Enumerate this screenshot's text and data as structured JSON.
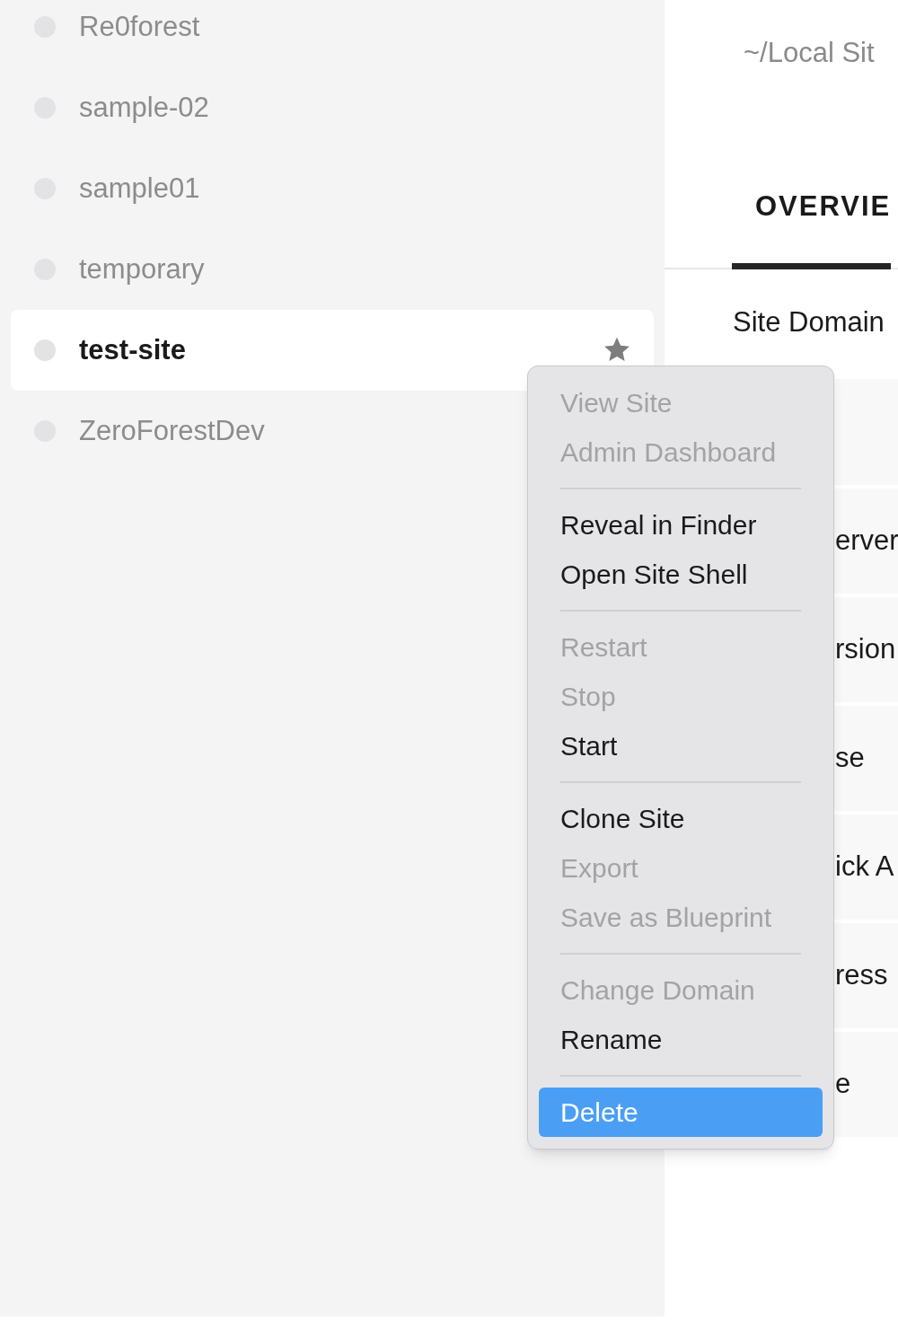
{
  "sidebar": {
    "items": [
      {
        "label": "Re0forest",
        "selected": false,
        "starred": false
      },
      {
        "label": "sample-02",
        "selected": false,
        "starred": false
      },
      {
        "label": "sample01",
        "selected": false,
        "starred": false
      },
      {
        "label": "temporary",
        "selected": false,
        "starred": false
      },
      {
        "label": "test-site",
        "selected": true,
        "starred": true
      },
      {
        "label": "ZeroForestDev",
        "selected": false,
        "starred": false
      }
    ]
  },
  "main": {
    "path": "~/Local Sit",
    "tabs": [
      {
        "label": "OVERVIE",
        "selected": true
      }
    ],
    "rows": [
      {
        "label": "Site Domain",
        "kind": "full"
      },
      {
        "label": "",
        "kind": "blank"
      },
      {
        "label": "erver",
        "kind": "covered"
      },
      {
        "label": "rsion",
        "kind": "covered"
      },
      {
        "label": "se",
        "kind": "covered"
      },
      {
        "label": "ick A",
        "kind": "covered"
      },
      {
        "label": "ress",
        "kind": "covered"
      },
      {
        "label": "e",
        "kind": "covered"
      }
    ]
  },
  "context_menu": {
    "groups": [
      [
        {
          "label": "View Site",
          "disabled": true,
          "selected": false
        },
        {
          "label": "Admin Dashboard",
          "disabled": true,
          "selected": false
        }
      ],
      [
        {
          "label": "Reveal in Finder",
          "disabled": false,
          "selected": false
        },
        {
          "label": "Open Site Shell",
          "disabled": false,
          "selected": false
        }
      ],
      [
        {
          "label": "Restart",
          "disabled": true,
          "selected": false
        },
        {
          "label": "Stop",
          "disabled": true,
          "selected": false
        },
        {
          "label": "Start",
          "disabled": false,
          "selected": false
        }
      ],
      [
        {
          "label": "Clone Site",
          "disabled": false,
          "selected": false
        },
        {
          "label": "Export",
          "disabled": true,
          "selected": false
        },
        {
          "label": "Save as Blueprint",
          "disabled": true,
          "selected": false
        }
      ],
      [
        {
          "label": "Change Domain",
          "disabled": true,
          "selected": false
        },
        {
          "label": "Rename",
          "disabled": false,
          "selected": false
        }
      ],
      [
        {
          "label": "Delete",
          "disabled": false,
          "selected": true
        }
      ]
    ]
  }
}
